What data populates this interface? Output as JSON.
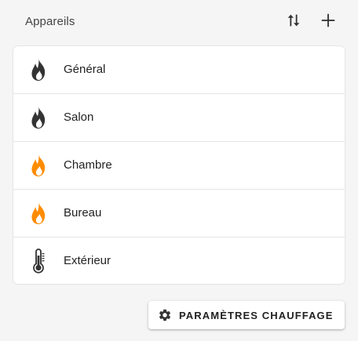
{
  "header": {
    "title": "Appareils",
    "sort_icon": "sort-arrows-icon",
    "add_icon": "plus-icon"
  },
  "devices": [
    {
      "label": "Général",
      "icon": "flame-icon",
      "icon_color": "#333333"
    },
    {
      "label": "Salon",
      "icon": "flame-icon",
      "icon_color": "#333333"
    },
    {
      "label": "Chambre",
      "icon": "flame-icon",
      "icon_color": "#ff8c00"
    },
    {
      "label": "Bureau",
      "icon": "flame-icon",
      "icon_color": "#ff8c00"
    },
    {
      "label": "Extérieur",
      "icon": "thermometer-icon",
      "icon_color": "#333333"
    }
  ],
  "settings_button": {
    "label": "PARAMÈTRES CHAUFFAGE",
    "icon": "gear-icon"
  },
  "colors": {
    "background": "#f5f5f5",
    "card": "#ffffff",
    "active_flame": "#ff8c00",
    "idle_icon": "#333333"
  }
}
